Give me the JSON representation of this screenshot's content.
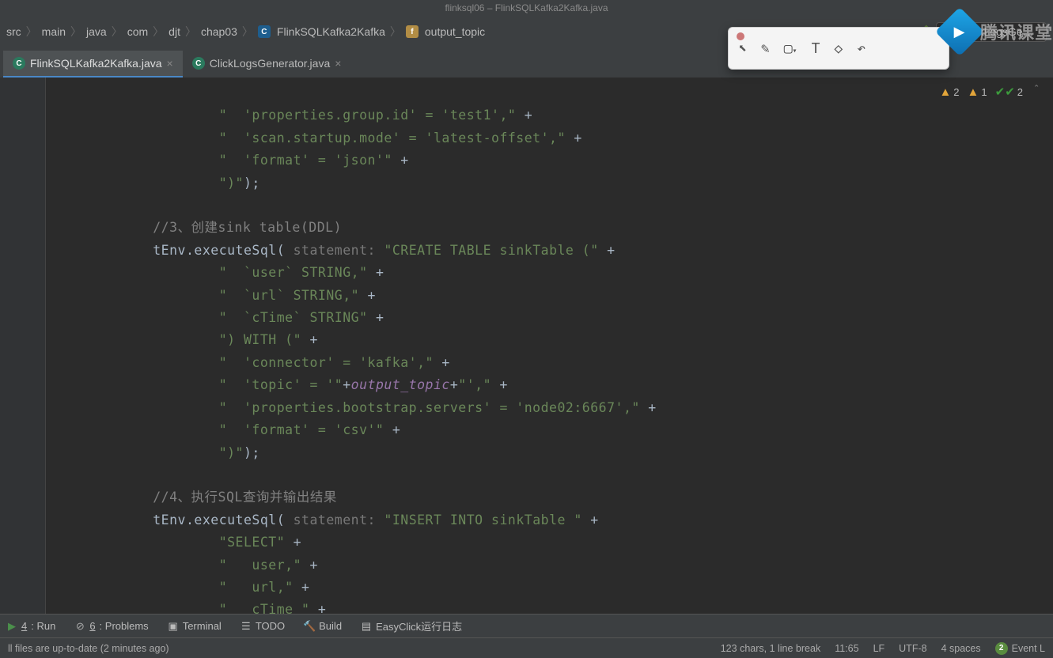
{
  "window": {
    "title": "flinksql06 – FlinkSQLKafka2Kafka.java"
  },
  "breadcrumb": {
    "items": [
      "src",
      "main",
      "java",
      "com",
      "djt",
      "chap03"
    ],
    "class_item": "FlinkSQLKafka2Kafka",
    "field_item": "output_topic"
  },
  "run_config": {
    "label": "ClickLogsGe…"
  },
  "tabs": [
    {
      "label": "FlinkSQLKafka2Kafka.java",
      "active": true
    },
    {
      "label": "ClickLogsGenerator.java",
      "active": false
    }
  ],
  "inspections": {
    "warn1": "2",
    "warn2": "1",
    "ok": "2"
  },
  "overlay_brand": "腾讯课堂",
  "code": {
    "l1a": "\"  'properties.group.id' = 'test1',\"",
    "plus": "+",
    "l2a": "\"  'scan.startup.mode' = 'latest-offset',\"",
    "l3a": "\"  'format' = 'json'\"",
    "l4a": "\")\"",
    "l4b": ");",
    "c1": "//3、创建sink table(DDL)",
    "l5a": "tEnv.executeSql(",
    "l5hint": " statement: ",
    "l5b": "\"CREATE TABLE sinkTable (\"",
    "l6a": "\"  `user` STRING,\"",
    "l7a": "\"  `url` STRING,\"",
    "l8a": "\"  `cTime` STRING\"",
    "l9a": "\") WITH (\"",
    "l10a": "\"  'connector' = 'kafka',\"",
    "l11a": "\"  'topic' = '\"",
    "l11f": "output_topic",
    "l11b": "\"',\"",
    "l12a": "\"  'properties.bootstrap.servers' = 'node02:6667',\"",
    "l13a": "\"  'format' = 'csv'\"",
    "l14a": "\")\"",
    "l14b": ");",
    "c2": "//4、执行SQL查询并输出结果",
    "l15a": "tEnv.executeSql(",
    "l15hint": " statement: ",
    "l15b": "\"INSERT INTO sinkTable \"",
    "l16a": "\"SELECT\"",
    "l17a": "\"   user,\"",
    "l18a": "\"   url,\"",
    "l19a": "\"   cTime \""
  },
  "toolwindows": {
    "run": {
      "key": "4",
      "label": ": Run"
    },
    "problems": {
      "key": "6",
      "label": ": Problems"
    },
    "terminal": "Terminal",
    "todo": "TODO",
    "build": "Build",
    "easyclick": "EasyClick运行日志"
  },
  "status": {
    "left": "ll files are up-to-date (2 minutes ago)",
    "selection": "123 chars, 1 line break",
    "caret": "11:65",
    "lf": "LF",
    "encoding": "UTF-8",
    "indent": "4 spaces",
    "event_count": "2",
    "event_label": "Event L"
  }
}
